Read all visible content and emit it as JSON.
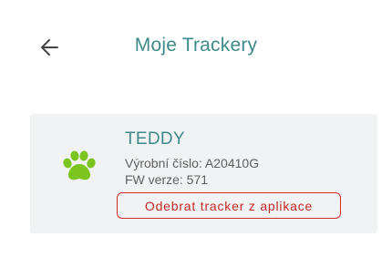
{
  "header": {
    "title": "Moje Trackery",
    "back_icon": "arrow-left-icon"
  },
  "tracker": {
    "icon": "paw-icon",
    "icon_color": "#7cc41e",
    "name": "TEDDY",
    "serial": "Výrobní číslo: A20410G",
    "fw": "FW verze: 571",
    "remove_label": "Odebrat tracker z aplikace"
  },
  "colors": {
    "accent": "#3f8a8a",
    "danger": "#d62b2b",
    "card_bg": "#f1f2f3"
  }
}
